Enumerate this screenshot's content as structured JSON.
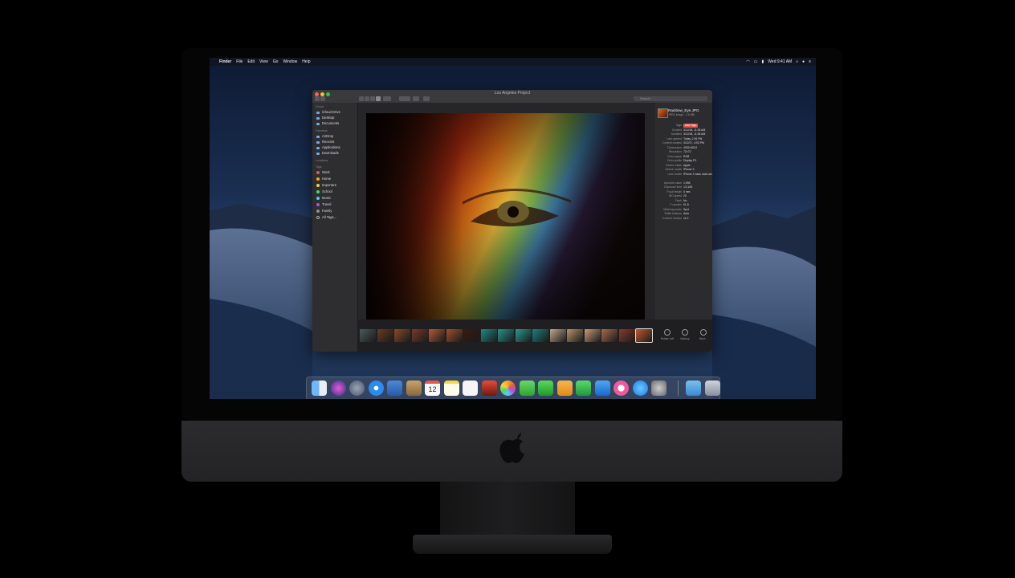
{
  "menubar": {
    "app_name": "Finder",
    "menus": [
      "File",
      "Edit",
      "View",
      "Go",
      "Window",
      "Help"
    ],
    "clock": "Wed 9:41 AM"
  },
  "finder": {
    "title": "Los Angeles Project",
    "search_placeholder": "Search",
    "sidebar": {
      "sections": [
        {
          "header": "iCloud",
          "items": [
            "iCloud Drive",
            "Desktop",
            "Documents"
          ]
        },
        {
          "header": "Favorites",
          "items": [
            "AirDrop",
            "Recents",
            "Applications",
            "Downloads"
          ]
        },
        {
          "header": "Locations",
          "items": []
        },
        {
          "header": "Tags",
          "items": [
            "Work",
            "Home",
            "Important",
            "School",
            "Music",
            "Travel",
            "Family",
            "All Tags..."
          ]
        }
      ],
      "tag_colors": [
        "#e8574b",
        "#f5a623",
        "#f0d33a",
        "#4cd964",
        "#5ac8fa",
        "#af52de",
        "#8e8e93",
        null
      ]
    },
    "info": {
      "file_name": "Rainbow_Eye.JPG",
      "file_sub": "JPEG image - 2.6 MB",
      "rows": [
        {
          "k": "Tags",
          "v": "Add Tags",
          "badge": true
        },
        {
          "k": "Created",
          "v": "3/12/18, 11:36 AM"
        },
        {
          "k": "Modified",
          "v": "3/12/18, 11:36 AM"
        },
        {
          "k": "Last opened",
          "v": "Today, 2:26 PM"
        },
        {
          "k": "Content created",
          "v": "3/22/17, 4:53 PM"
        },
        {
          "k": "Dimensions",
          "v": "4032×3024"
        },
        {
          "k": "Resolution",
          "v": "72×72"
        },
        {
          "k": "Color space",
          "v": "RGB"
        },
        {
          "k": "Color profile",
          "v": "Display P3"
        },
        {
          "k": "Device make",
          "v": "Apple"
        },
        {
          "k": "Device model",
          "v": "iPhone X"
        },
        {
          "k": "Lens model",
          "v": "iPhone X back dual camera 4mm f/1.8"
        },
        {
          "k": "",
          "v": ""
        },
        {
          "k": "Aperture value",
          "v": "1.696"
        },
        {
          "k": "Exposure time",
          "v": "1/2,183"
        },
        {
          "k": "Focal length",
          "v": "4 mm"
        },
        {
          "k": "ISO speed",
          "v": "20"
        },
        {
          "k": "Flash",
          "v": "No"
        },
        {
          "k": "F number",
          "v": "f/1.8"
        },
        {
          "k": "Metering mode",
          "v": "Spot"
        },
        {
          "k": "White balance",
          "v": "Auto"
        },
        {
          "k": "Content Creator",
          "v": "11.2"
        }
      ]
    },
    "actions": [
      "Rotate Left",
      "Markup",
      "More..."
    ]
  },
  "dock_icons": [
    "finder-icon",
    "siri-icon",
    "launchpad-icon",
    "safari-icon",
    "photo-browser-icon",
    "contacts-icon",
    "calendar-icon",
    "notes-icon",
    "reminders-icon",
    "photo-booth-icon",
    "photos-icon",
    "messages-icon",
    "facetime-icon",
    "pages-icon",
    "numbers-icon",
    "keynote-icon",
    "itunes-icon",
    "app-store-icon",
    "system-preferences-icon",
    "downloads-folder-icon",
    "trash-icon"
  ],
  "calendar_day": "12"
}
